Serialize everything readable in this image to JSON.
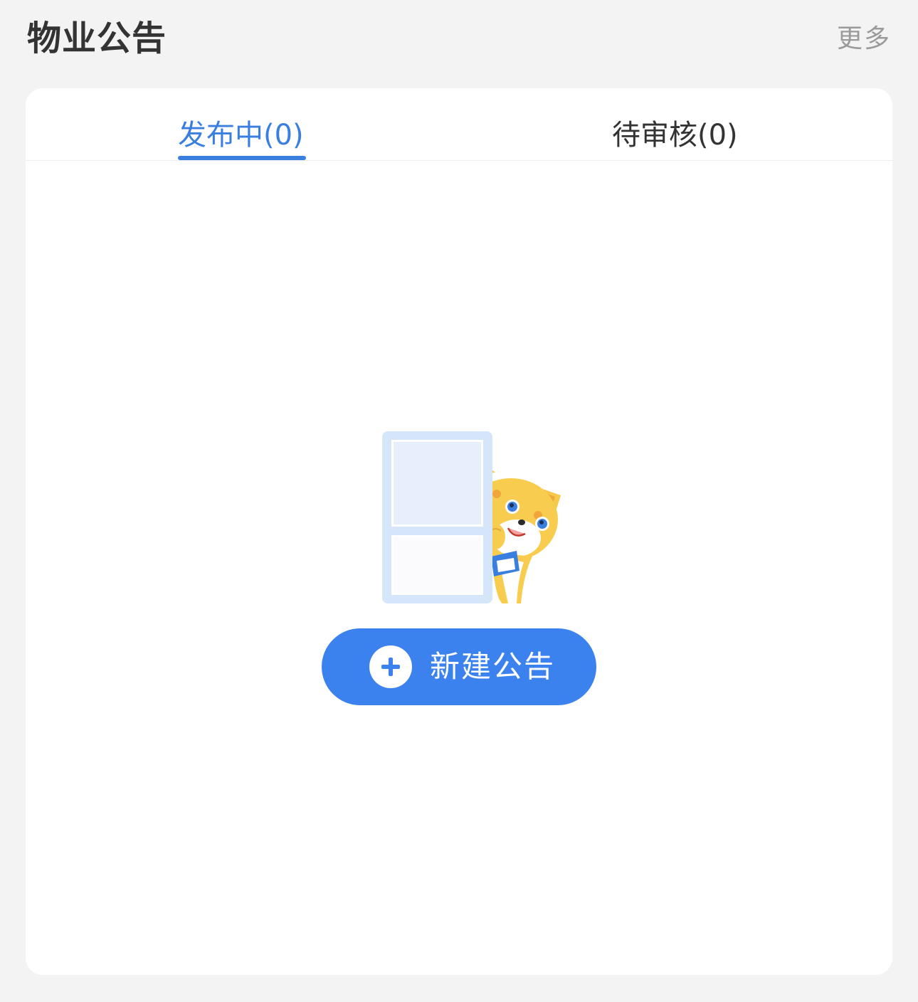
{
  "header": {
    "title": "物业公告",
    "more_label": "更多"
  },
  "tabs": [
    {
      "label": "发布中(0)",
      "active": true
    },
    {
      "label": "待审核(0)",
      "active": false
    }
  ],
  "empty_state": {
    "illustration": "cat-peeking-behind-door-icon",
    "new_button_label": "新建公告",
    "new_button_icon": "plus-circle-icon"
  },
  "colors": {
    "accent": "#3a7fe0",
    "button": "#3b82ef",
    "background": "#f3f3f3"
  }
}
